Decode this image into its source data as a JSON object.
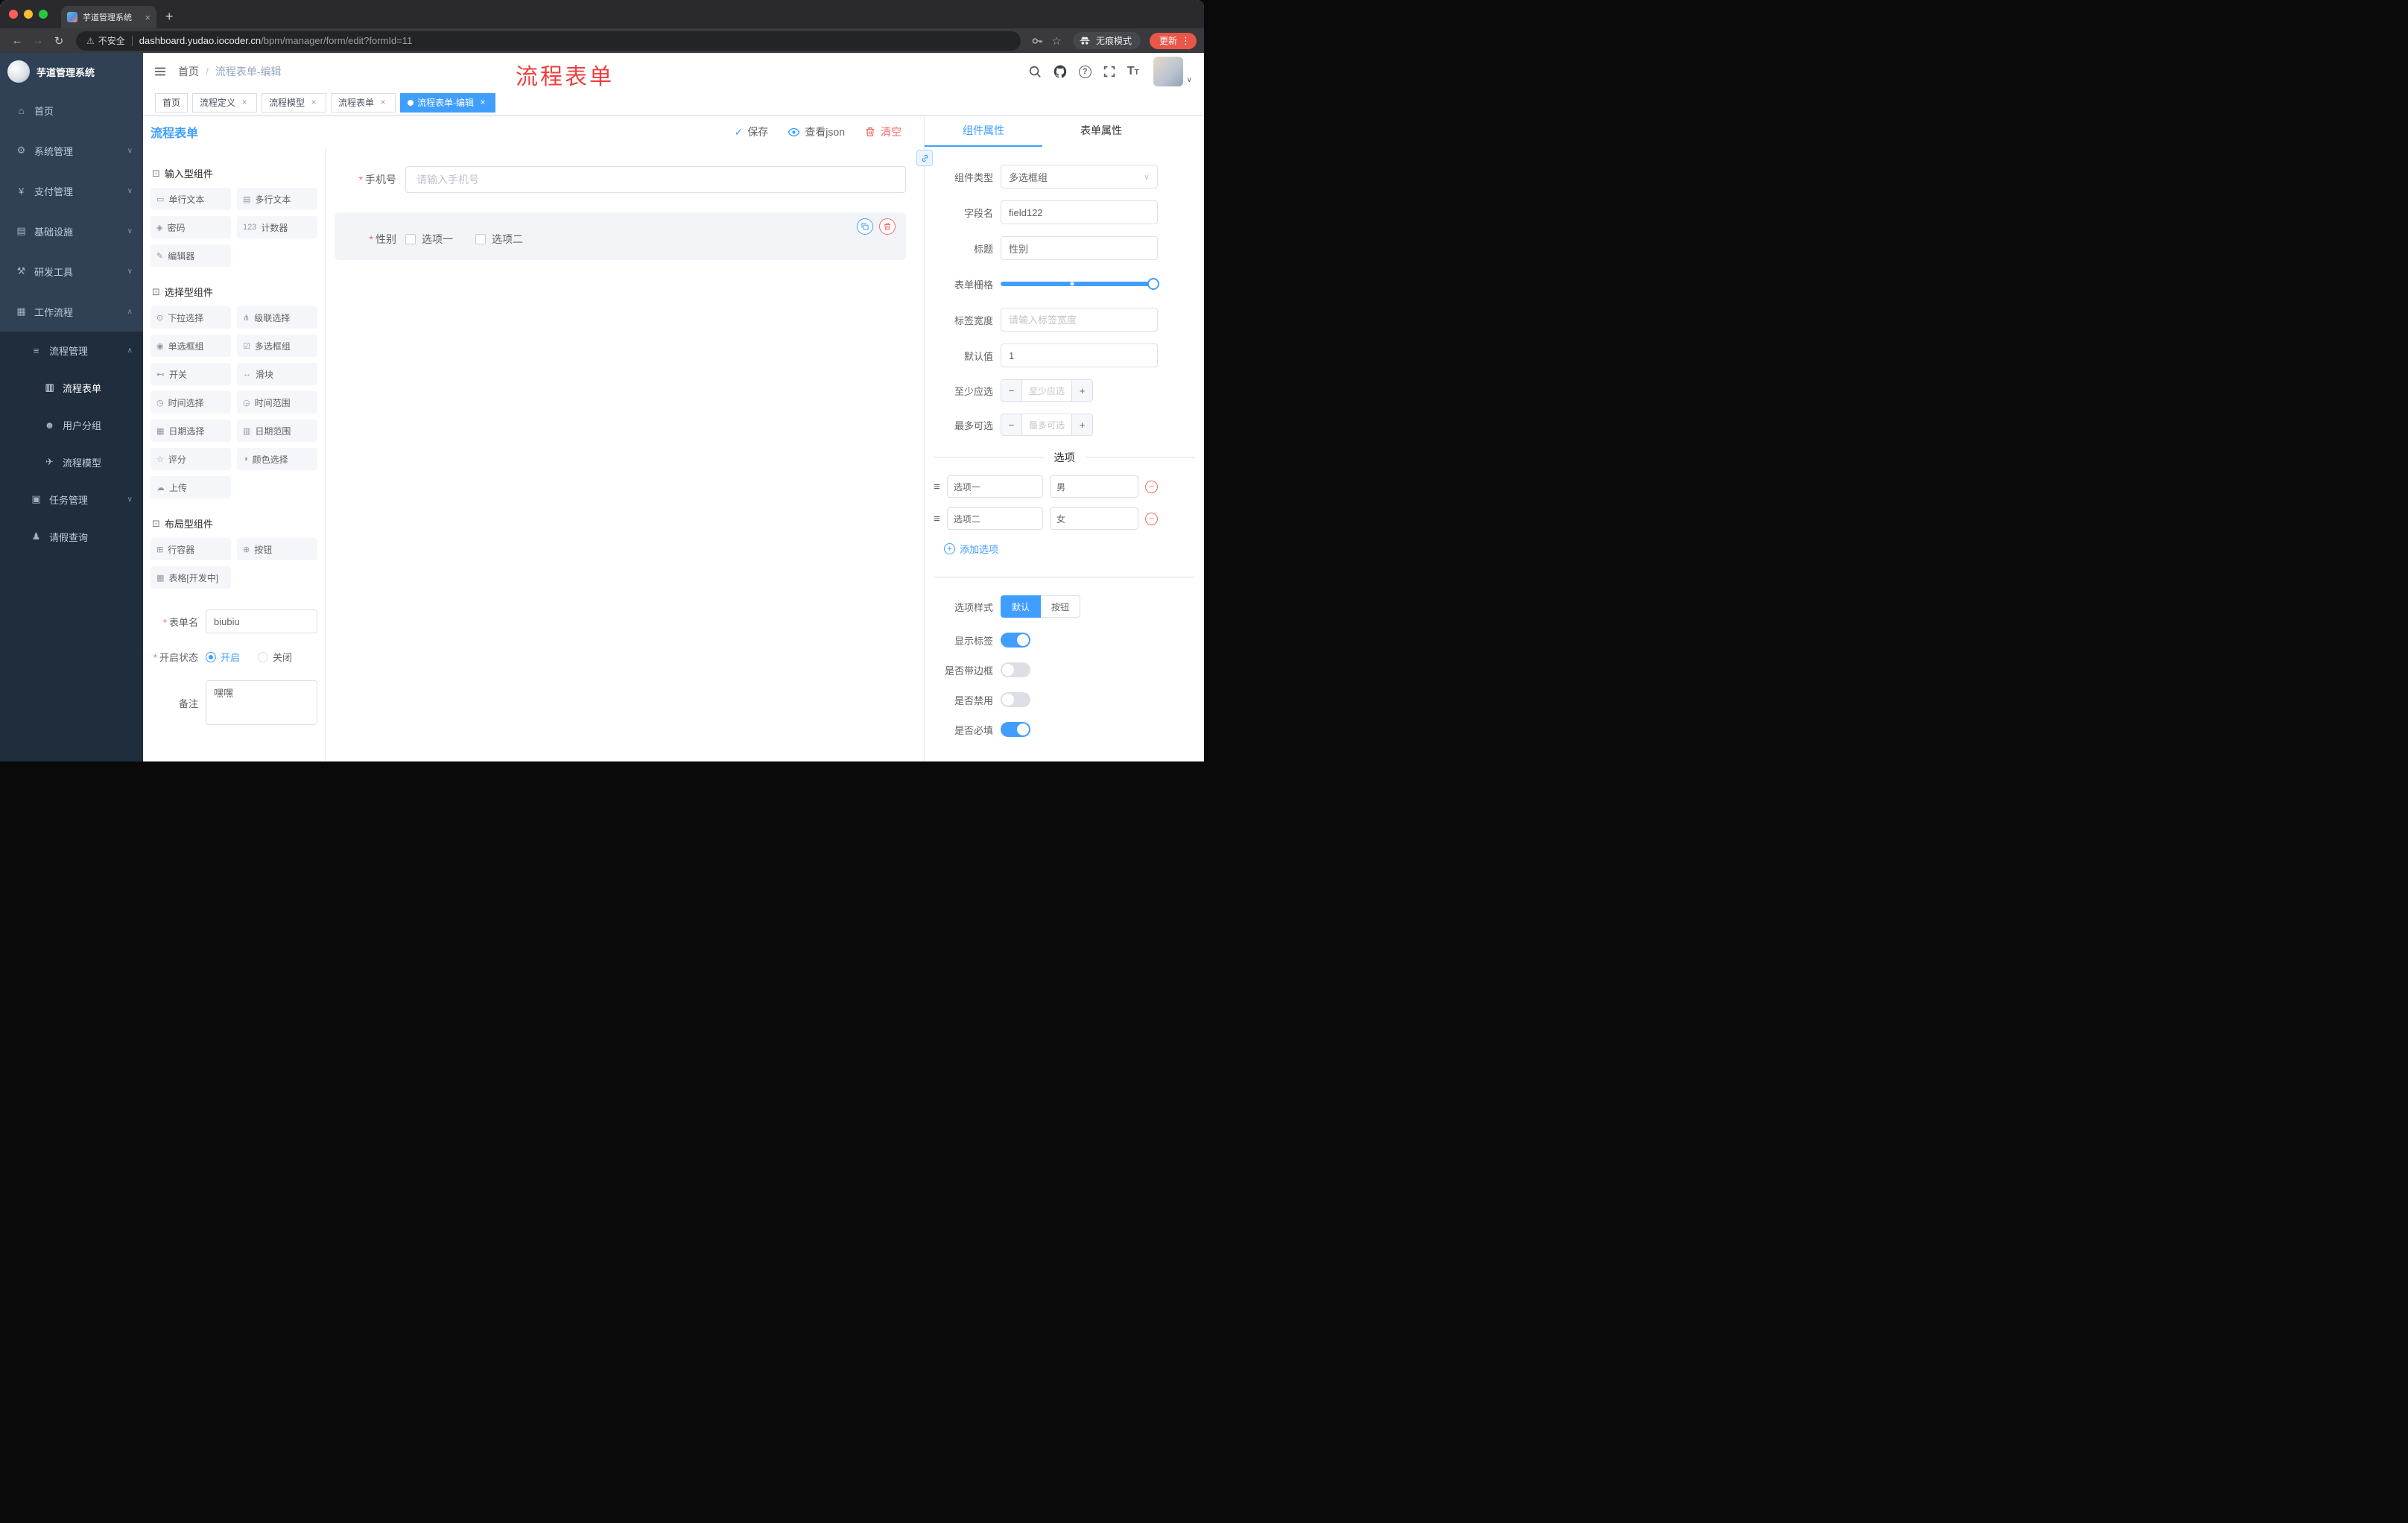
{
  "browser": {
    "tab_title": "芋道管理系统",
    "security_label": "不安全",
    "url_host": "dashboard.yudao.iocoder.cn",
    "url_path": "/bpm/manager/form/edit?formId=11",
    "incognito_label": "无痕模式",
    "update_label": "更新"
  },
  "icons": {
    "close": "×",
    "plus": "+",
    "minus": "−",
    "back": "←",
    "forward": "→",
    "reload": "↻",
    "warning": "⚠",
    "star": "☆",
    "more_vertical": "⋮",
    "chevron_down": "∨",
    "chevron_up": "∧",
    "question": "?",
    "font_large": "T",
    "font_small": "T",
    "drag": "≡",
    "check": "✓"
  },
  "sidebar": {
    "logo_title": "芋道管理系统",
    "items": [
      {
        "label": "首页",
        "glyph": "⌂"
      },
      {
        "label": "系统管理",
        "glyph": "⚙",
        "arrow": "∨"
      },
      {
        "label": "支付管理",
        "glyph": "¥",
        "arrow": "∨"
      },
      {
        "label": "基础设施",
        "glyph": "▤",
        "arrow": "∨"
      },
      {
        "label": "研发工具",
        "glyph": "⚒",
        "arrow": "∨"
      },
      {
        "label": "工作流程",
        "glyph": "▦",
        "arrow": "∧"
      },
      {
        "label": "流程管理",
        "glyph": "≡",
        "arrow": "∧"
      },
      {
        "label": "流程表单",
        "glyph": "▥"
      },
      {
        "label": "用户分组",
        "glyph": "☻"
      },
      {
        "label": "流程模型",
        "glyph": "✈"
      },
      {
        "label": "任务管理",
        "glyph": "▣",
        "arrow": "∨"
      },
      {
        "label": "请假查询",
        "glyph": "♟"
      }
    ]
  },
  "header": {
    "breadcrumb": [
      "首页",
      "流程表单-编辑"
    ],
    "breadcrumb_separator": "/",
    "annotation": "流程表单"
  },
  "tags": [
    {
      "label": "首页",
      "closable": false,
      "active": false
    },
    {
      "label": "流程定义",
      "closable": true,
      "active": false
    },
    {
      "label": "流程模型",
      "closable": true,
      "active": false
    },
    {
      "label": "流程表单",
      "closable": true,
      "active": false
    },
    {
      "label": "流程表单-编辑",
      "closable": true,
      "active": true
    }
  ],
  "editor": {
    "title": "流程表单",
    "actions": {
      "save": "保存",
      "view_json": "查看json",
      "clear": "清空"
    }
  },
  "palette": {
    "sections": [
      {
        "title": "输入型组件",
        "icon": "⊡",
        "items": [
          {
            "label": "单行文本",
            "icon": "▭"
          },
          {
            "label": "多行文本",
            "icon": "▤"
          },
          {
            "label": "密码",
            "icon": "◈"
          },
          {
            "label": "计数器",
            "icon": "123"
          },
          {
            "label": "编辑器",
            "icon": "✎"
          }
        ]
      },
      {
        "title": "选择型组件",
        "icon": "⊡",
        "items": [
          {
            "label": "下拉选择",
            "icon": "⊙"
          },
          {
            "label": "级联选择",
            "icon": "⋔"
          },
          {
            "label": "单选框组",
            "icon": "◉"
          },
          {
            "label": "多选框组",
            "icon": "☑"
          },
          {
            "label": "开关",
            "icon": "⊷"
          },
          {
            "label": "滑块",
            "icon": "↔"
          },
          {
            "label": "时间选择",
            "icon": "◷"
          },
          {
            "label": "时间范围",
            "icon": "◶"
          },
          {
            "label": "日期选择",
            "icon": "▦"
          },
          {
            "label": "日期范围",
            "icon": "▥"
          },
          {
            "label": "评分",
            "icon": "☆"
          },
          {
            "label": "颜色选择",
            "icon": "◑"
          },
          {
            "label": "上传",
            "icon": "☁"
          }
        ]
      },
      {
        "title": "布局型组件",
        "icon": "⊡",
        "items": [
          {
            "label": "行容器",
            "icon": "⊞"
          },
          {
            "label": "按钮",
            "icon": "⊕"
          },
          {
            "label": "表格[开发中]",
            "icon": "▦"
          }
        ]
      }
    ]
  },
  "meta_form": {
    "form_name": {
      "label": "表单名",
      "required": true,
      "value": "biubiu"
    },
    "status": {
      "label": "开启状态",
      "required": true,
      "options": [
        {
          "label": "开启",
          "selected": true
        },
        {
          "label": "关闭",
          "selected": false
        }
      ]
    },
    "remark": {
      "label": "备注",
      "value": "嘿嘿"
    }
  },
  "canvas": {
    "fields": [
      {
        "label": "手机号",
        "required": true,
        "type": "input",
        "placeholder": "请输入手机号"
      },
      {
        "label": "性别",
        "required": true,
        "type": "checkbox-group",
        "options": [
          "选项一",
          "选项二"
        ],
        "selected": true
      }
    ]
  },
  "props": {
    "tabs": [
      {
        "label": "组件属性",
        "active": true
      },
      {
        "label": "表单属性",
        "active": false
      }
    ],
    "fields": {
      "component_type": {
        "label": "组件类型",
        "value": "多选框组"
      },
      "field_name": {
        "label": "字段名",
        "value": "field122"
      },
      "title": {
        "label": "标题",
        "value": "性别"
      },
      "grid": {
        "label": "表单栅格"
      },
      "label_width": {
        "label": "标签宽度",
        "placeholder": "请输入标签宽度"
      },
      "default_value": {
        "label": "默认值",
        "value": "1"
      },
      "min_select": {
        "label": "至少应选",
        "placeholder": "至少应选"
      },
      "max_select": {
        "label": "最多可选",
        "placeholder": "最多可选"
      }
    },
    "options_section": {
      "title": "选项",
      "options": [
        {
          "label": "选项一",
          "value": "男"
        },
        {
          "label": "选项二",
          "value": "女"
        }
      ],
      "add_label": "添加选项"
    },
    "style_row": {
      "label": "选项样式",
      "choices": [
        {
          "label": "默认",
          "active": true
        },
        {
          "label": "按钮",
          "active": false
        }
      ]
    },
    "switches": [
      {
        "label": "显示标签",
        "on": true
      },
      {
        "label": "是否带边框",
        "on": false
      },
      {
        "label": "是否禁用",
        "on": false
      },
      {
        "label": "是否必填",
        "on": true
      }
    ]
  },
  "colors": {
    "primary": "#409eff",
    "danger": "#f56c6c",
    "sidebar_bg": "#304156",
    "sidebar_sub_bg": "#1f2d3d",
    "annotation_red": "#f03e3e"
  }
}
